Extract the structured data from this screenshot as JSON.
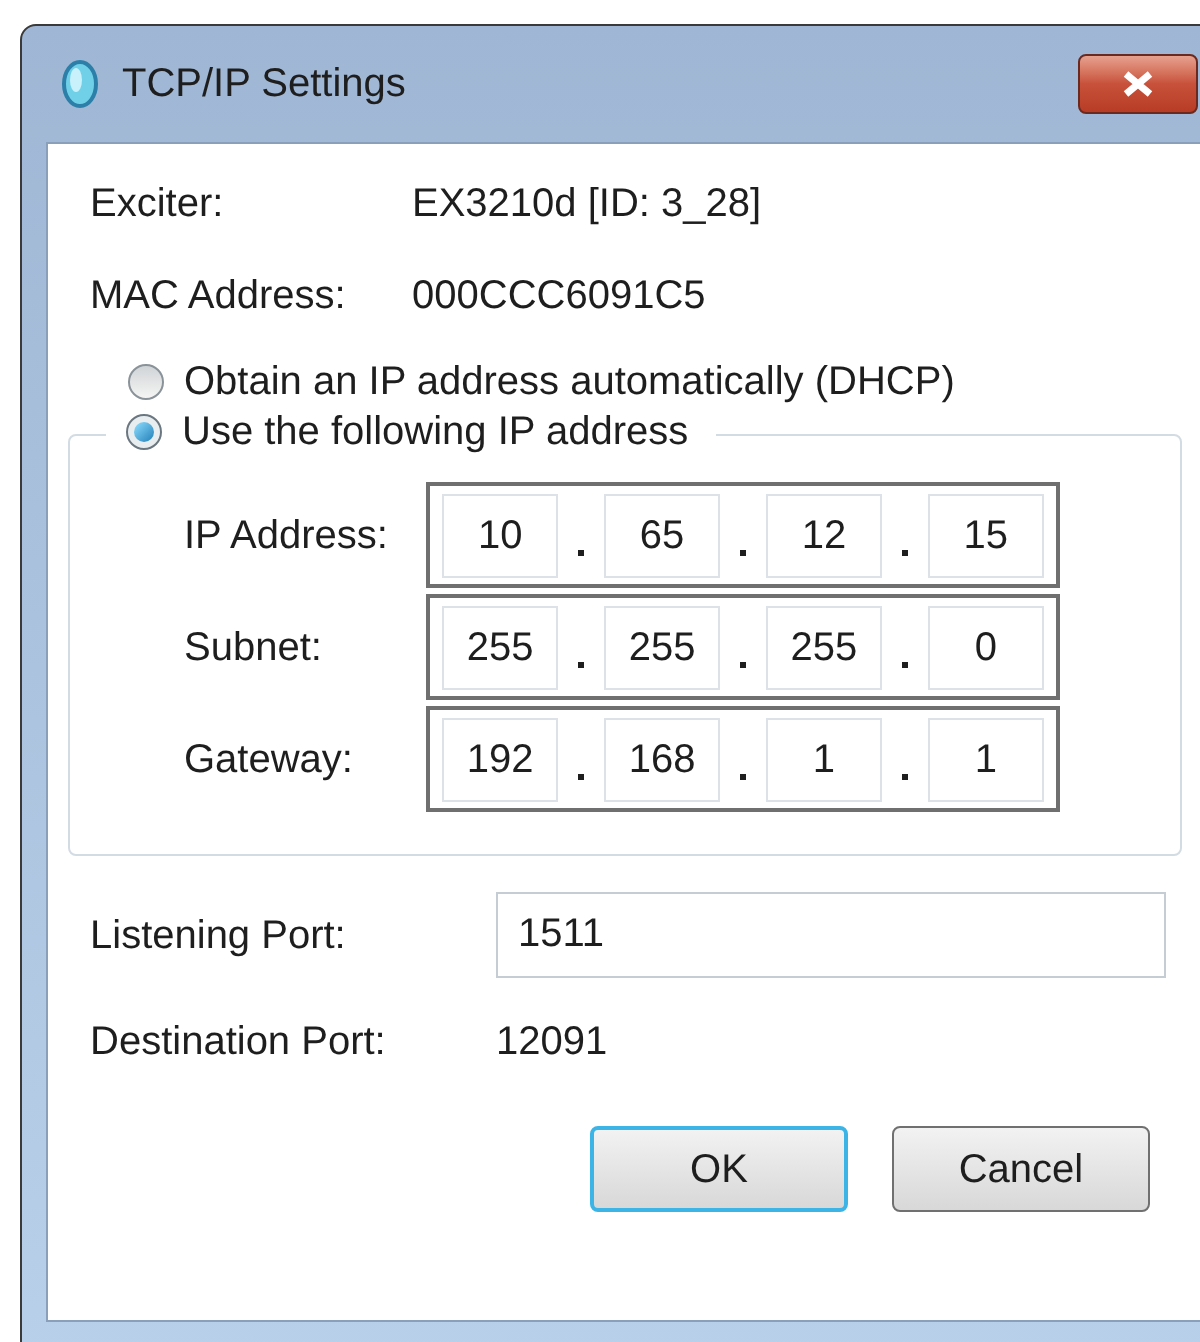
{
  "window": {
    "title": "TCP/IP Settings"
  },
  "info": [
    {
      "label": "Exciter:",
      "value": "EX3210d [ID: 3_28]"
    },
    {
      "label": "MAC Address:",
      "value": "000CCC6091C5"
    }
  ],
  "modes": [
    {
      "label": "Obtain an IP address automatically (DHCP)",
      "selected": false
    },
    {
      "label": "Use the following IP address",
      "selected": true
    }
  ],
  "addresses": [
    {
      "label": "IP Address:",
      "octets": [
        "10",
        "65",
        "12",
        "15"
      ]
    },
    {
      "label": "Subnet:",
      "octets": [
        "255",
        "255",
        "255",
        "0"
      ]
    },
    {
      "label": "Gateway:",
      "octets": [
        "192",
        "168",
        "1",
        "1"
      ]
    }
  ],
  "listening_port": {
    "label": "Listening Port:",
    "value": "1511"
  },
  "destination_port": {
    "label": "Destination Port:",
    "value": "12091"
  },
  "buttons": [
    {
      "label": "OK",
      "default": true
    },
    {
      "label": "Cancel",
      "default": false
    }
  ]
}
